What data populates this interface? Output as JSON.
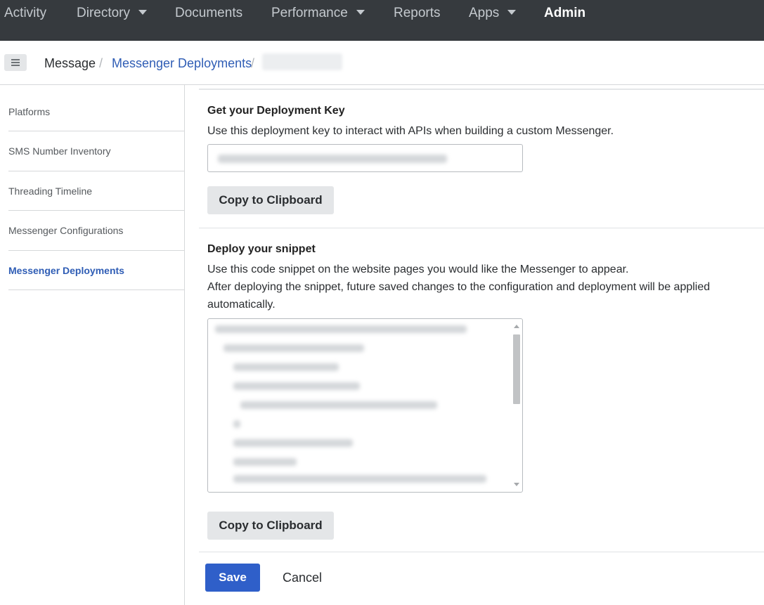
{
  "topnav": {
    "items": [
      {
        "label": "Activity",
        "has_caret": false
      },
      {
        "label": "Directory",
        "has_caret": true
      },
      {
        "label": "Documents",
        "has_caret": false
      },
      {
        "label": "Performance",
        "has_caret": true
      },
      {
        "label": "Reports",
        "has_caret": false
      },
      {
        "label": "Apps",
        "has_caret": true
      },
      {
        "label": "Admin",
        "has_caret": false,
        "active": true
      }
    ],
    "bg_color": "#363a3e"
  },
  "breadcrumb": {
    "menu_icon": "hamburger-icon",
    "items": [
      {
        "label": "Message"
      },
      {
        "label": "Messenger Deployments"
      }
    ],
    "separator": "/",
    "current_redacted": true
  },
  "sidebar": {
    "items": [
      {
        "label": "Platforms"
      },
      {
        "label": "SMS Number Inventory"
      },
      {
        "label": "Threading Timeline"
      },
      {
        "label": "Messenger Configurations"
      },
      {
        "label": "Messenger Deployments",
        "active": true
      }
    ]
  },
  "deployment_key": {
    "heading": "Get your Deployment Key",
    "description": "Use this deployment key to interact with APIs when building a custom Messenger.",
    "value_redacted": true,
    "copy_label": "Copy to Clipboard"
  },
  "snippet": {
    "heading": "Deploy your snippet",
    "description_1": "Use this code snippet on the website pages you would like the Messenger to appear.",
    "description_2": "After deploying the snippet, future saved changes to the configuration and deployment will be applied automatically.",
    "code_redacted": true,
    "copy_label": "Copy to Clipboard"
  },
  "actions": {
    "save_label": "Save",
    "cancel_label": "Cancel",
    "primary_color": "#2f5fc9"
  }
}
